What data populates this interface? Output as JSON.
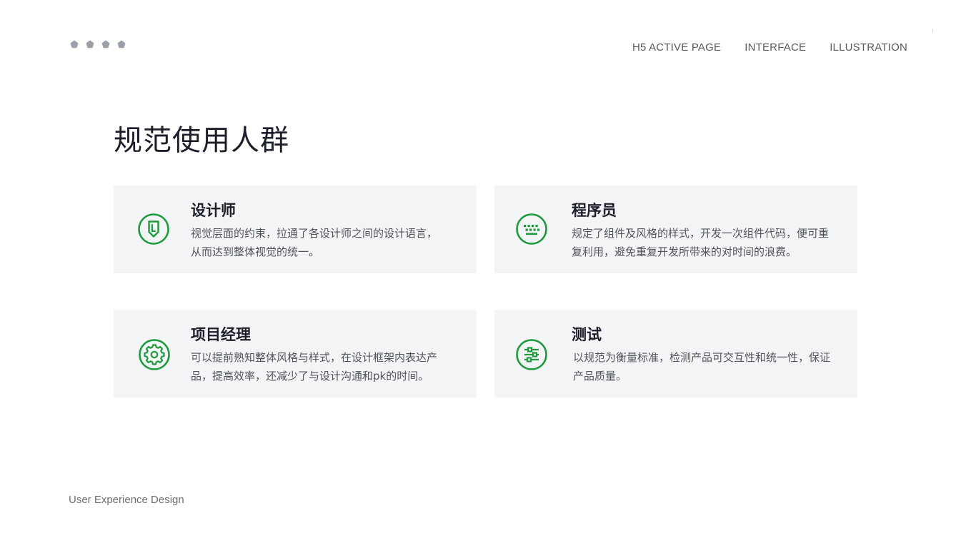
{
  "header": {
    "logo_icon": "pentagon-dots",
    "nav": [
      {
        "label": "H5 ACTIVE PAGE"
      },
      {
        "label": "INTERFACE"
      },
      {
        "label": "ILLUSTRATION"
      }
    ]
  },
  "main": {
    "title": "规范使用人群",
    "cards": [
      {
        "icon": "pencil-icon",
        "title": "设计师",
        "desc_line1": "视觉层面的约束，拉通了各设计师之间的设计语言，",
        "desc_line2": "从而达到整体视觉的统一。"
      },
      {
        "icon": "keyboard-icon",
        "title": "程序员",
        "desc_line1": "规定了组件及风格的样式，开发一次组件代码，便可重",
        "desc_line2": "复利用，避免重复开发所带来的对时间的浪费。"
      },
      {
        "icon": "gear-icon",
        "title": "项目经理",
        "desc_line1": "可以提前熟知整体风格与样式，在设计框架内表达产",
        "desc_line2": "品，提高效率，还减少了与设计沟通和pk的时间。"
      },
      {
        "icon": "sliders-icon",
        "title": "测试",
        "desc_line1": "以规范为衡量标准，检测产品可交互性和统一性，保证",
        "desc_line2": "产品质量。"
      }
    ]
  },
  "footer": {
    "text": "User Experience Design"
  },
  "colors": {
    "accent": "#1e9a3c",
    "card_bg": "#f3f4f6",
    "logo_dot": "#9ba0a8"
  }
}
